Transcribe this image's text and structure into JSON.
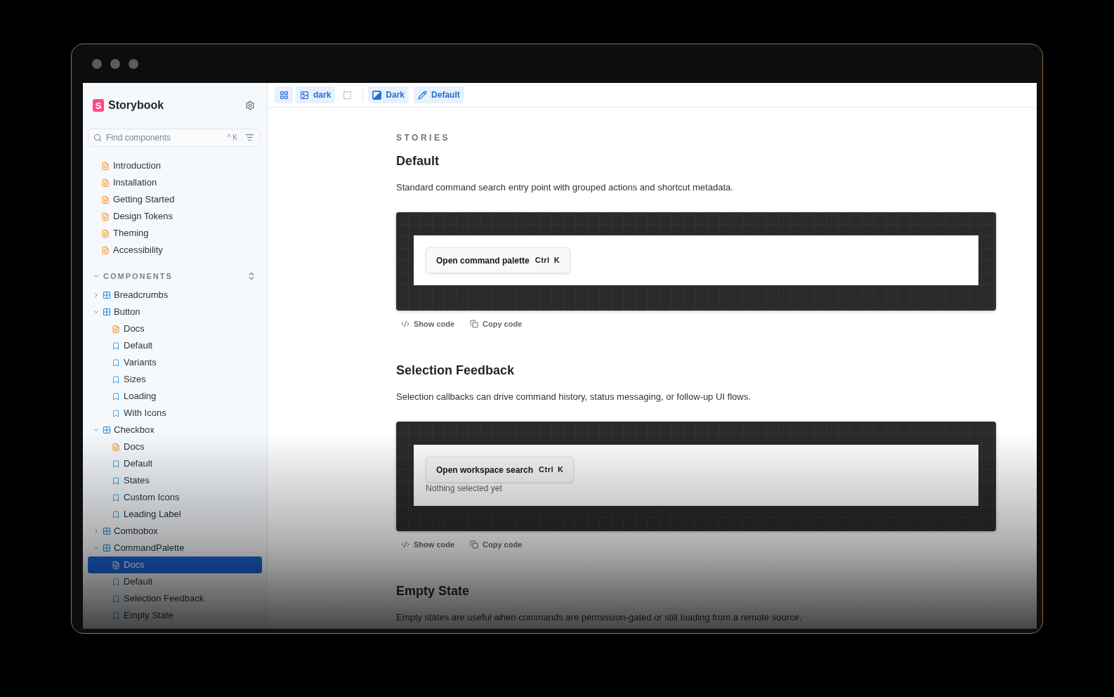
{
  "sidebar": {
    "brand": {
      "mark": "S",
      "name": "Storybook"
    },
    "search": {
      "placeholder": "Find components",
      "shortcut": "^K"
    },
    "pages": [
      {
        "label": "Introduction",
        "selected": false
      },
      {
        "label": "Installation",
        "selected": false
      },
      {
        "label": "Getting Started",
        "selected": false
      },
      {
        "label": "Design Tokens",
        "selected": false
      },
      {
        "label": "Theming",
        "selected": false
      },
      {
        "label": "Accessibility",
        "selected": false
      }
    ],
    "components_section": {
      "label": "COMPONENTS",
      "expanded": true,
      "tree": [
        {
          "label": "Breadcrumbs",
          "expanded": false
        },
        {
          "label": "Button",
          "expanded": true,
          "children": [
            {
              "label": "Docs",
              "kind": "docs",
              "selected": false
            },
            {
              "label": "Default",
              "kind": "story",
              "selected": false
            },
            {
              "label": "Variants",
              "kind": "story",
              "selected": false
            },
            {
              "label": "Sizes",
              "kind": "story",
              "selected": false
            },
            {
              "label": "Loading",
              "kind": "story",
              "selected": false
            },
            {
              "label": "With Icons",
              "kind": "story",
              "selected": false
            }
          ]
        },
        {
          "label": "Checkbox",
          "expanded": true,
          "children": [
            {
              "label": "Docs",
              "kind": "docs",
              "selected": false
            },
            {
              "label": "Default",
              "kind": "story",
              "selected": false
            },
            {
              "label": "States",
              "kind": "story",
              "selected": false
            },
            {
              "label": "Custom Icons",
              "kind": "story",
              "selected": false
            },
            {
              "label": "Leading Label",
              "kind": "story",
              "selected": false
            }
          ]
        },
        {
          "label": "Combobox",
          "expanded": false
        },
        {
          "label": "CommandPalette",
          "expanded": true,
          "children": [
            {
              "label": "Docs",
              "kind": "docs",
              "selected": true
            },
            {
              "label": "Default",
              "kind": "story",
              "selected": false
            },
            {
              "label": "Selection Feedback",
              "kind": "story",
              "selected": false
            },
            {
              "label": "Empty State",
              "kind": "story",
              "selected": false
            }
          ]
        }
      ]
    }
  },
  "toolbar": {
    "grid_toggle": {
      "active": true
    },
    "background": {
      "label": "dark",
      "active": true
    },
    "outline_toggle": {
      "active": false
    },
    "theme": {
      "label": "Dark",
      "active": true
    },
    "variant": {
      "label": "Default",
      "active": true
    }
  },
  "docs": {
    "section_label": "STORIES",
    "stories": [
      {
        "title": "Default",
        "description": "Standard command search entry point with grouped actions and shortcut metadata.",
        "preview": {
          "button": "Open command palette",
          "shortcut": [
            "Ctrl",
            "K"
          ]
        },
        "actions": [
          {
            "kind": "show",
            "label": "Show code"
          },
          {
            "kind": "copy",
            "label": "Copy code"
          }
        ]
      },
      {
        "title": "Selection Feedback",
        "description": "Selection callbacks can drive command history, status messaging, or follow-up UI flows.",
        "preview": {
          "button": "Open workspace search",
          "shortcut": [
            "Ctrl",
            "K"
          ],
          "status": "Nothing selected yet"
        },
        "actions": [
          {
            "kind": "show",
            "label": "Show code"
          },
          {
            "kind": "copy",
            "label": "Copy code"
          }
        ]
      },
      {
        "title": "Empty State",
        "description": "Empty states are useful when commands are permission-gated or still loading from a remote source."
      }
    ]
  }
}
